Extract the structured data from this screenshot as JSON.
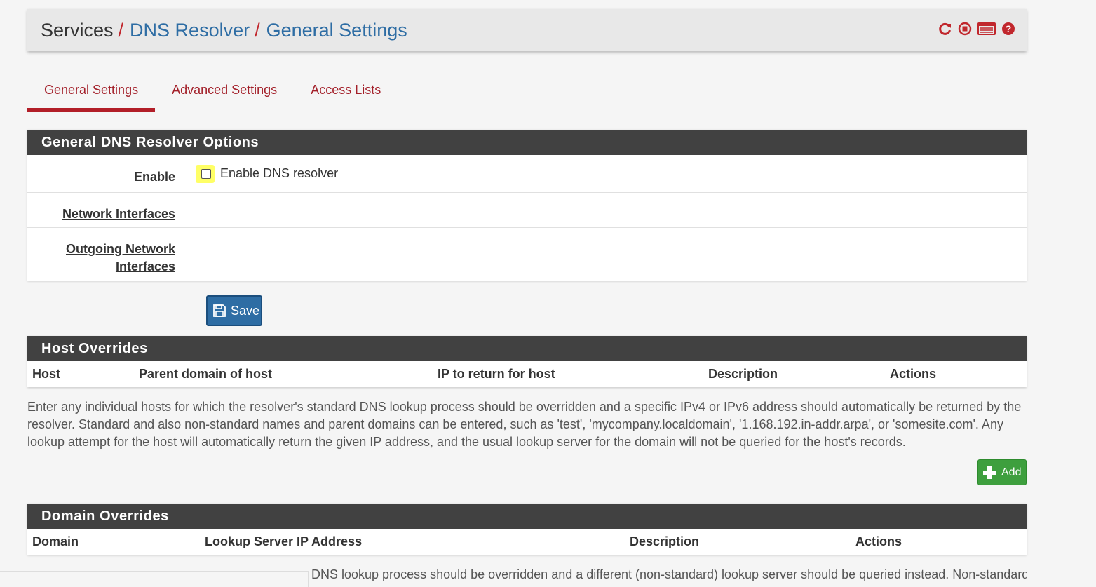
{
  "breadcrumb": {
    "root": "Services",
    "separator": "/",
    "level2": "DNS Resolver",
    "level3": "General Settings"
  },
  "header_icons": [
    "reload-icon",
    "stop-icon",
    "log-icon",
    "help-icon"
  ],
  "tabs": [
    {
      "label": "General Settings",
      "active": true
    },
    {
      "label": "Advanced Settings",
      "active": false
    },
    {
      "label": "Access Lists",
      "active": false
    }
  ],
  "general_panel": {
    "title": "General DNS Resolver Options",
    "enable_label": "Enable",
    "enable_checkbox_label": "Enable DNS resolver",
    "enable_checked": false,
    "network_interfaces_label": "Network Interfaces",
    "outgoing_label_line1": "Outgoing Network",
    "outgoing_label_line2": "Interfaces"
  },
  "save_button": {
    "label": "Save"
  },
  "host_overrides": {
    "title": "Host Overrides",
    "columns": [
      "Host",
      "Parent domain of host",
      "IP to return for host",
      "Description",
      "Actions"
    ],
    "description": "Enter any individual hosts for which the resolver's standard DNS lookup process should be overridden and a specific IPv4 or IPv6 address should automatically be returned by the resolver. Standard and also non-standard names and parent domains can be entered, such as 'test', 'mycompany.localdomain', '1.168.192.in-addr.arpa', or 'somesite.com'. Any lookup attempt for the host will automatically return the given IP address, and the usual lookup server for the domain will not be queried for the host's records.",
    "add_label": "Add"
  },
  "domain_overrides": {
    "title": "Domain Overrides",
    "columns": [
      "Domain",
      "Lookup Server IP Address",
      "Description",
      "Actions"
    ],
    "description_partial": "DNS lookup process should be overridden and a different (non-standard) lookup server should be queried instead. Non-standard,"
  },
  "colors": {
    "accent_red": "#b21e28",
    "link_blue": "#2e6da4",
    "panel_header": "#414141",
    "add_green": "#3e9f3e",
    "highlight_yellow": "#ffff66"
  }
}
